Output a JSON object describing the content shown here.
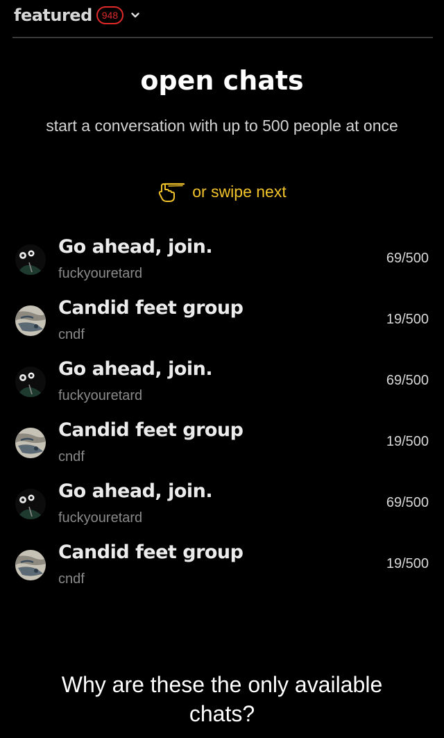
{
  "header": {
    "tab_title": "featured",
    "badge_count": "948",
    "dropdown_icon": "chevron-down-icon"
  },
  "main": {
    "heading": "open chats",
    "subtitle": "start a conversation with up to 500 people at once",
    "swipe_hint": "or swipe next",
    "swipe_icon": "hand-pointing-icon"
  },
  "chats": [
    {
      "title": "Go ahead, join.",
      "owner": "fuckyouretard",
      "members": "69/500",
      "avatar": "avatar-dark"
    },
    {
      "title": "Candid feet group",
      "owner": "cndf",
      "members": "19/500",
      "avatar": "avatar-light"
    },
    {
      "title": "Go ahead, join.",
      "owner": "fuckyouretard",
      "members": "69/500",
      "avatar": "avatar-dark"
    },
    {
      "title": "Candid feet group",
      "owner": "cndf",
      "members": "19/500",
      "avatar": "avatar-light"
    },
    {
      "title": "Go ahead, join.",
      "owner": "fuckyouretard",
      "members": "69/500",
      "avatar": "avatar-dark"
    },
    {
      "title": "Candid feet group",
      "owner": "cndf",
      "members": "19/500",
      "avatar": "avatar-light"
    }
  ],
  "caption": {
    "text": "Why are these the only available chats?"
  },
  "colors": {
    "background": "#000000",
    "badge": "#e02a2a",
    "swipe_hint": "#f2c32a",
    "owner_text": "#8a8a8a"
  }
}
